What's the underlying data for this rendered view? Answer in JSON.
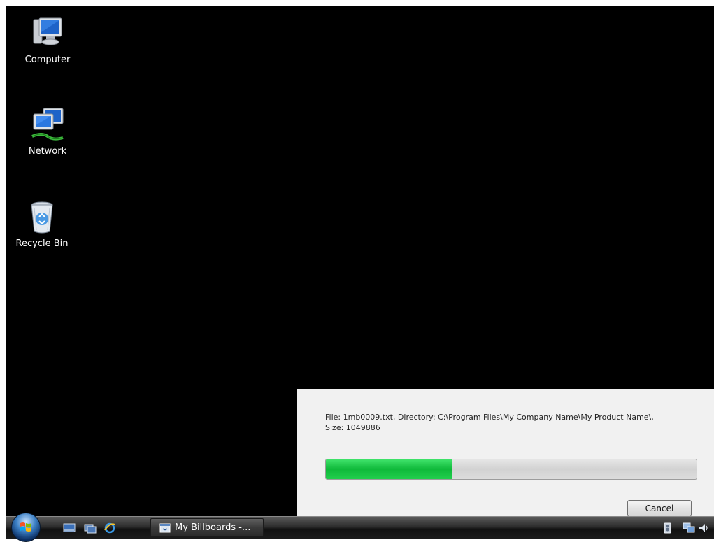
{
  "desktop": {
    "background": "#000000",
    "icons": [
      {
        "label": "Computer",
        "icon": "computer-icon"
      },
      {
        "label": "Network",
        "icon": "network-icon"
      },
      {
        "label": "Recycle Bin",
        "icon": "recycle-bin-icon"
      }
    ]
  },
  "dialog": {
    "file_info_line1": "File: 1mb0009.txt,  Directory: C:\\Program Files\\My Company Name\\My Product Name\\,",
    "file_info_line2": "Size: 1049886",
    "progress_fraction": 0.34,
    "progress_color": "#1ec546",
    "cancel_label": "Cancel"
  },
  "taskbar": {
    "start_icon": "windows-start-orb-icon",
    "quick_launch": [
      {
        "icon": "show-desktop-icon"
      },
      {
        "icon": "switch-windows-icon"
      },
      {
        "icon": "internet-explorer-icon"
      }
    ],
    "task_button": {
      "label": "My Billboards -...",
      "icon": "app-window-icon"
    },
    "tray": [
      {
        "icon": "speaker-tray-icon"
      },
      {
        "icon": "network-tray-icon"
      },
      {
        "icon": "volume-icon"
      }
    ]
  }
}
